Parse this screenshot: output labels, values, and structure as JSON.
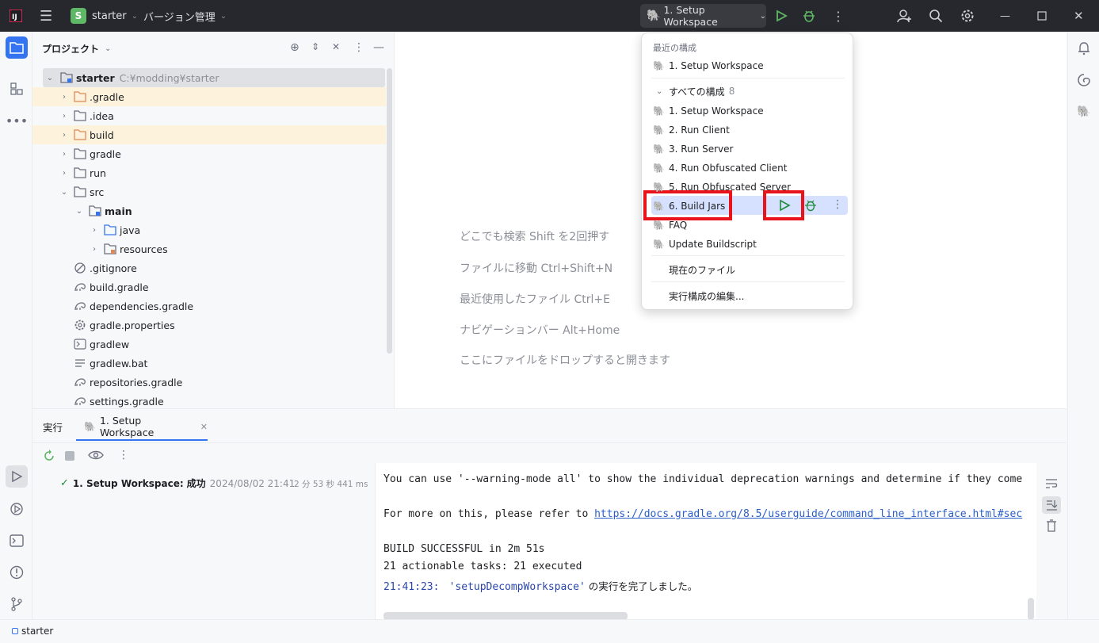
{
  "titlebar": {
    "project_badge": "S",
    "project_name": "starter",
    "vcs_label": "バージョン管理",
    "run_config": "1. Setup Workspace"
  },
  "project_panel": {
    "title": "プロジェクト",
    "root_name": "starter",
    "root_path": "C:¥modding¥starter",
    "items": [
      {
        "label": ".gradle",
        "type": "folder-orange",
        "indent": 1,
        "chevron": "›"
      },
      {
        "label": ".idea",
        "type": "folder",
        "indent": 1,
        "chevron": "›"
      },
      {
        "label": "build",
        "type": "folder-orange",
        "indent": 1,
        "chevron": "›"
      },
      {
        "label": "gradle",
        "type": "folder",
        "indent": 1,
        "chevron": "›"
      },
      {
        "label": "run",
        "type": "folder",
        "indent": 1,
        "chevron": "›"
      },
      {
        "label": "src",
        "type": "folder",
        "indent": 1,
        "chevron": "⌄"
      },
      {
        "label": "main",
        "type": "folder-module",
        "indent": 2,
        "chevron": "⌄"
      },
      {
        "label": "java",
        "type": "folder-blue",
        "indent": 3,
        "chevron": "›"
      },
      {
        "label": "resources",
        "type": "folder-res",
        "indent": 3,
        "chevron": "›"
      },
      {
        "label": ".gitignore",
        "type": "ignore",
        "indent": 1,
        "chevron": ""
      },
      {
        "label": "build.gradle",
        "type": "gradle",
        "indent": 1,
        "chevron": ""
      },
      {
        "label": "dependencies.gradle",
        "type": "gradle",
        "indent": 1,
        "chevron": ""
      },
      {
        "label": "gradle.properties",
        "type": "gear",
        "indent": 1,
        "chevron": ""
      },
      {
        "label": "gradlew",
        "type": "shell",
        "indent": 1,
        "chevron": ""
      },
      {
        "label": "gradlew.bat",
        "type": "text",
        "indent": 1,
        "chevron": ""
      },
      {
        "label": "repositories.gradle",
        "type": "gradle",
        "indent": 1,
        "chevron": ""
      },
      {
        "label": "settings.gradle",
        "type": "gradle",
        "indent": 1,
        "chevron": ""
      }
    ]
  },
  "editor_hints": [
    "どこでも検索 Shift を2回押す",
    "ファイルに移動 Ctrl+Shift+N",
    "最近使用したファイル Ctrl+E",
    "ナビゲーションバー Alt+Home",
    "ここにファイルをドロップすると開きます"
  ],
  "popup": {
    "recent_header": "最近の構成",
    "recent_item": "1. Setup Workspace",
    "all_header": "すべての構成",
    "all_count": "8",
    "all_items": [
      "1. Setup Workspace",
      "2. Run Client",
      "3. Run Server",
      "4. Run Obfuscated Client",
      "5. Run Obfuscated Server",
      "6. Build Jars",
      "FAQ",
      "Update Buildscript"
    ],
    "current_file": "現在のファイル",
    "edit_configs": "実行構成の編集..."
  },
  "run_panel": {
    "tab_run": "実行",
    "tab_config": "1. Setup Workspace",
    "tree_item": "1. Setup Workspace:",
    "tree_status": "成功",
    "tree_date": "2024/08/02 21:41",
    "tree_duration": "2 分 53 秒 441 ms"
  },
  "console": {
    "line1": "You can use '--warning-mode all' to show the individual deprecation warnings and determine if they come",
    "line2_prefix": "For more on this, please refer to ",
    "line2_link": "https://docs.gradle.org/8.5/userguide/command_line_interface.html#sec",
    "line3": "BUILD SUCCESSFUL in 2m 51s",
    "line4": "21 actionable tasks: 21 executed",
    "line5_time": "21:41:23:",
    "line5_task": "'setupDecompWorkspace'",
    "line5_suffix": " の実行を完了しました。"
  },
  "statusbar": {
    "project": "starter"
  },
  "colors": {
    "accent": "#3574f0",
    "success": "#208a3c",
    "highlight_red": "#e8131b",
    "link": "#2a5ec9"
  }
}
